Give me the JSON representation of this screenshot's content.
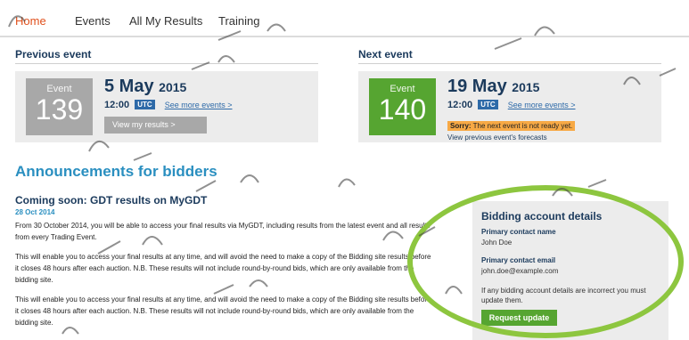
{
  "nav": {
    "items": [
      "Home",
      "Events",
      "All My Results",
      "Training"
    ]
  },
  "previous_event": {
    "section_title": "Previous event",
    "badge_label": "Event",
    "badge_number": "139",
    "date_day_month": "5 May",
    "date_year": "2015",
    "time": "12:00",
    "tz": "UTC",
    "see_more": "See more events >",
    "results_button": "View my results >"
  },
  "next_event": {
    "section_title": "Next event",
    "badge_label": "Event",
    "badge_number": "140",
    "date_day_month": "19 May",
    "date_year": "2015",
    "time": "12:00",
    "tz": "UTC",
    "see_more": "See more events >",
    "sorry_bold": "Sorry:",
    "sorry_text": "The next event is not ready yet.",
    "forecasts_link": "View previous event's forecasts"
  },
  "announcements": {
    "heading": "Announcements for bidders",
    "article_title": "Coming soon: GDT results on MyGDT",
    "article_date": "28 Oct 2014",
    "paragraphs": [
      "From 30 October 2014, you will be able to access your final results via MyGDT, including results from the latest event and all results from every Trading Event.",
      "This will enable you to access your final results at any time, and will avoid the need to make a copy of the Bidding site results before it closes 48 hours after each auction. N.B. These results will not include round-by-round bids, which are only available from the bidding site.",
      "This will enable you to access your final results at any time, and will avoid the need to make a copy of the Bidding site results before it closes 48 hours after each auction. N.B. These results will not include round-by-round bids, which are only available from the bidding site."
    ]
  },
  "account": {
    "title": "Bidding account details",
    "name_label": "Primary contact name",
    "name_value": "John Doe",
    "email_label": "Primary contact email",
    "email_value": "john.doe@example.com",
    "note": "If any bidding account details are incorrect you must update them.",
    "button": "Request update"
  },
  "colors": {
    "accent_orange": "#e0501c",
    "navy": "#1b3a5c",
    "link_blue": "#2e6aa8",
    "announce_blue": "#2a8fc0",
    "prev_badge": "#a8a8a8",
    "next_badge": "#56a531",
    "warning": "#f7a945",
    "highlight_ring": "#8dc63f"
  }
}
